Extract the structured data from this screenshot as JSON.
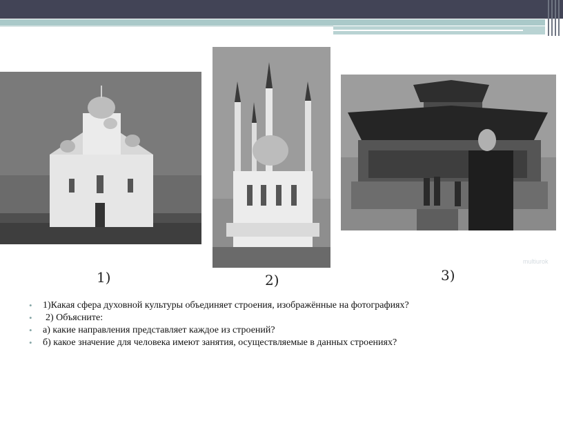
{
  "slide": {
    "captions": [
      "1)",
      "2)",
      "3)"
    ],
    "watermark": "multiurok",
    "photos": [
      {
        "name": "orthodox-church-photo"
      },
      {
        "name": "mosque-photo"
      },
      {
        "name": "buddhist-temple-photo"
      }
    ],
    "bullets": [
      "1)Какая сфера духовной культуры объединяет строения, изображённые на фотографиях?",
      "2) Объясните:",
      "а) какие направления представляет каждое из строений?",
      "б) какое значение для человека имеют занятия, осуществляемые в данных строениях?"
    ]
  }
}
